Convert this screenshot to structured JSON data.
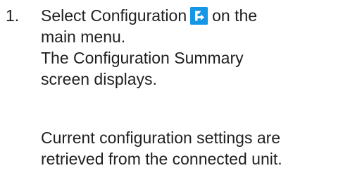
{
  "step": {
    "number": "1.",
    "instruction_before_icon": "Select Configuration",
    "instruction_after_icon": "on the",
    "instruction_line_2": "main menu.",
    "result_line_1": "The Configuration Summary",
    "result_line_2": "screen displays."
  },
  "note": {
    "line_1": "Current configuration settings are",
    "line_2": "retrieved from the connected unit."
  },
  "icons": {
    "configuration": "configuration-icon"
  },
  "colors": {
    "text": "#1f1f1f",
    "configuration_icon": "#1697e6"
  }
}
